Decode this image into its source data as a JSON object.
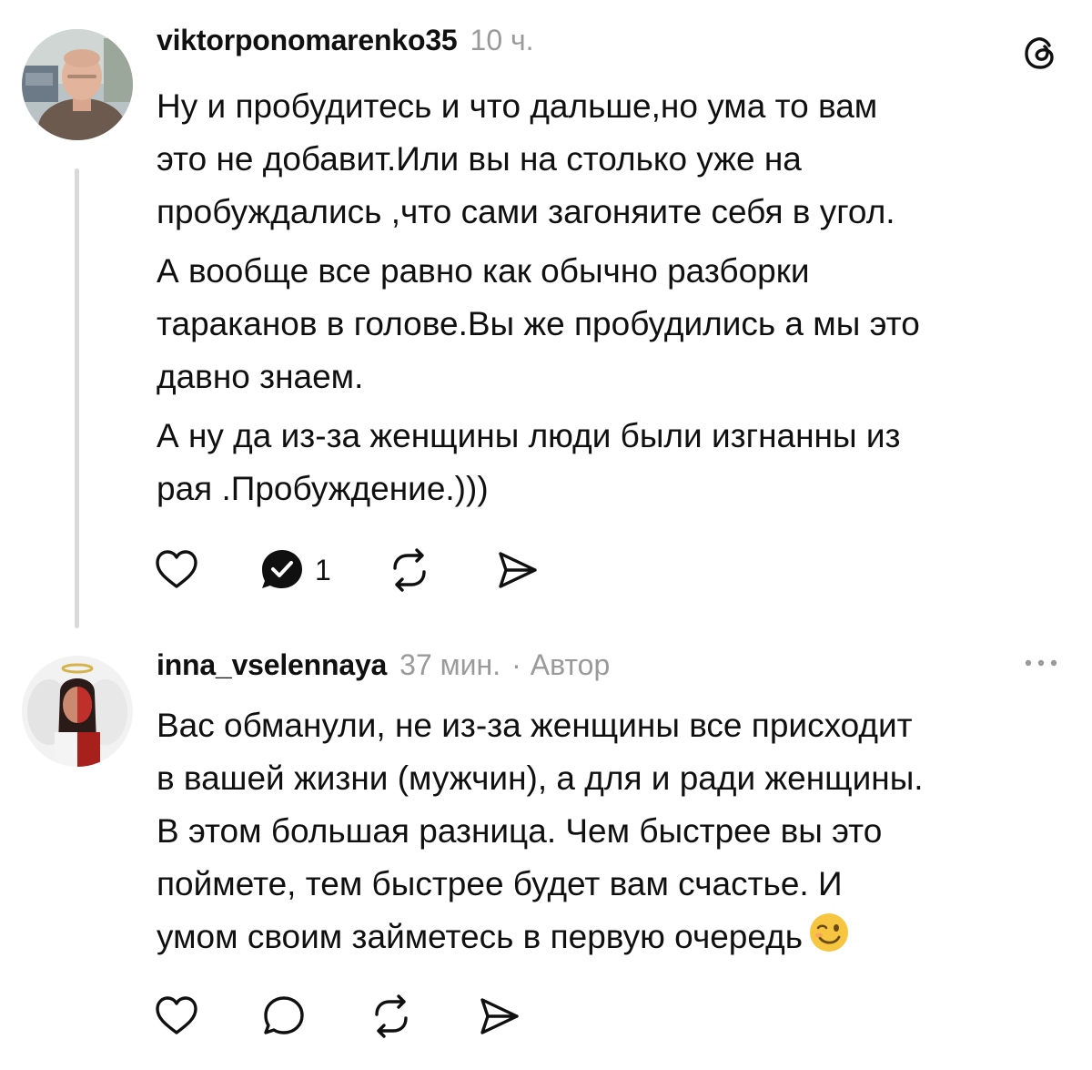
{
  "posts": [
    {
      "username": "viktorponomarenko35",
      "time": "10 ч.",
      "avatar_icon": "user-photo-man",
      "lines": [
        "Ну и пробудитесь и что дальше,но ума то вам",
        "это не добавит.Или вы на столько уже на",
        "пробуждались ,что сами загоняите себя в угол.",
        "А вообще все равно как обычно разборки",
        "тараканов в голове.Вы же пробудились а мы это",
        "давно знаем.",
        "А ну да из-за женщины люди были изгнанны из",
        "рая .Пробуждение.)))"
      ],
      "reply_count": "1",
      "icons": [
        "heart-icon",
        "replied-comment-icon",
        "repost-icon",
        "share-icon",
        "threads-logo-icon"
      ]
    },
    {
      "username": "inna_vselennaya",
      "time": "37 мин.",
      "separator": "·",
      "author_badge": "Автор",
      "avatar_icon": "user-photo-angel-devil",
      "lines": [
        "Вас обманули, не из-за женщины все присходит",
        "в вашей жизни (мужчин), а для и ради женщины.",
        "В этом большая разница. Чем быстрее вы это",
        "поймете, тем быстрее будет вам счастье. И",
        "умом своим займетесь в первую очередь"
      ],
      "emoji": "winking-face-emoji",
      "icons": [
        "heart-icon",
        "comment-icon",
        "repost-icon",
        "share-icon",
        "more-icon"
      ]
    }
  ],
  "colors": {
    "text": "#101010",
    "muted": "#9a9a9a",
    "thread_line": "#d9d9d9"
  }
}
